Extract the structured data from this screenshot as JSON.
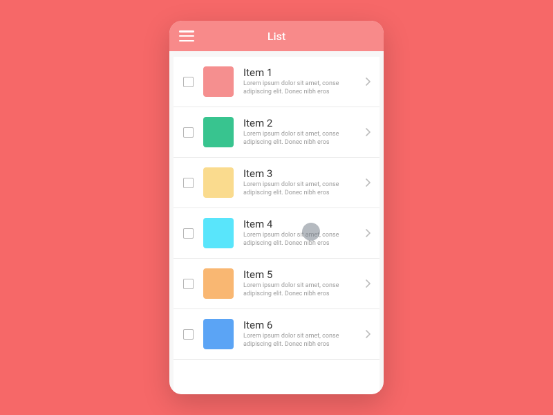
{
  "header": {
    "title": "List"
  },
  "list": {
    "items": [
      {
        "title": "Item 1",
        "desc": "Lorem ipsum dolor sit amet, conse adipiscing elit. Donec nibh eros",
        "color": "#f58f8f"
      },
      {
        "title": "Item 2",
        "desc": "Lorem ipsum dolor sit amet, conse adipiscing elit. Donec nibh eros",
        "color": "#38c48f"
      },
      {
        "title": "Item 3",
        "desc": "Lorem ipsum dolor sit amet, conse adipiscing elit. Donec nibh eros",
        "color": "#fadb8e"
      },
      {
        "title": "Item 4",
        "desc": "Lorem ipsum dolor sit amet, conse adipiscing elit. Donec nibh eros",
        "color": "#59e5fb"
      },
      {
        "title": "Item 5",
        "desc": "Lorem ipsum dolor sit amet, conse adipiscing elit. Donec nibh eros",
        "color": "#f9b772"
      },
      {
        "title": "Item 6",
        "desc": "Lorem ipsum dolor sit amet, conse adipiscing elit. Donec nibh eros",
        "color": "#5ba4f5"
      }
    ]
  }
}
